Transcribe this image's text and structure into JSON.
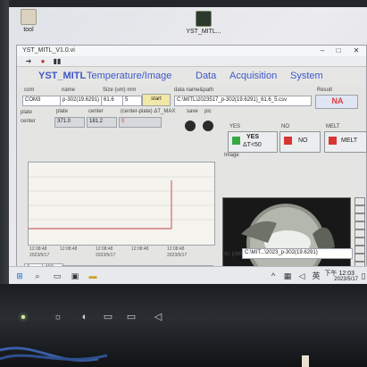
{
  "desktop": {
    "icons": [
      {
        "label": "tool"
      },
      {
        "label": "YST_MITL..."
      }
    ]
  },
  "window": {
    "title": "YST_MITL_V1.0.vi"
  },
  "menu": {
    "brand": "YST_MITL",
    "items": [
      "Temperature/Image",
      "Data",
      "Acquisition",
      "System"
    ]
  },
  "fields": {
    "com_label": "com",
    "com_value": "COM3",
    "name_label": "name",
    "name_value": "p-302(19.6291)",
    "size_label": "Size (um) mm",
    "size_value": "61.6",
    "size_value2": "5",
    "start_label": "start",
    "path_label": "data name&path",
    "path_value": "C:\\MITL\\2023517_p-302(19.6291)_61.6_5.csv",
    "result_label": "Result",
    "result_value": "NA",
    "plate_label": "plate",
    "plate_value": "371.0",
    "center_label": "center",
    "center_value": "181.2",
    "delta_label": "(center-plate) ΔT_MAX",
    "delta_value": "0",
    "save_label": "save",
    "pic_label": "pic",
    "legend_plate": "plate",
    "legend_center": "center",
    "x_start": "0",
    "x_end": "400",
    "pic_path_label": "pic path",
    "pic_path_value": "C:\\MIT...\\2023_p-302(19.6291)"
  },
  "chart_data": {
    "type": "line",
    "series": [
      {
        "name": "plate"
      },
      {
        "name": "center"
      }
    ],
    "x": [
      "2023/5/17",
      "2023/5/17",
      "2023/5/17",
      "2023/5/17",
      "2023/5/17",
      "2023/5/17"
    ],
    "x_times": [
      "12:08:48",
      "12:08:48",
      "12:08:48",
      "12:08:48",
      "12:08:48",
      "12:08:48"
    ]
  },
  "buttons": {
    "yes_top": "YES",
    "yes_main": "YES",
    "yes_sub": "ΔT<50",
    "no_top": "NO",
    "no_main": "NO",
    "melt_top": "MELT",
    "melt_main": "MELT",
    "image_label": "Image"
  },
  "taskbar": {
    "time": "下午 12:03",
    "date": "2023/5/17"
  }
}
